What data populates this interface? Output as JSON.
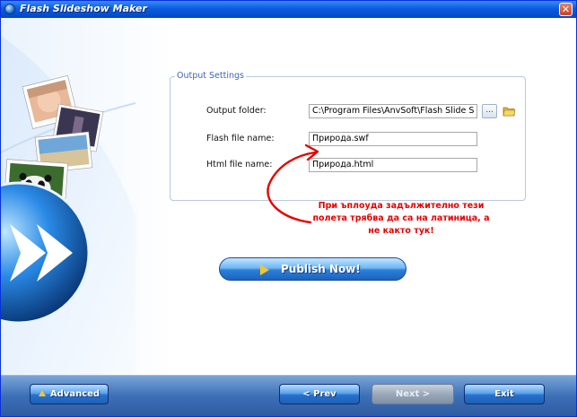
{
  "window": {
    "title": "Flash Slideshow Maker",
    "close_glyph": "✕"
  },
  "output_settings": {
    "legend": "Output Settings",
    "output_folder": {
      "label": "Output folder:",
      "value": "C:\\Program Files\\AnvSoft\\Flash Slide S",
      "browse_label": "..."
    },
    "flash_file": {
      "label": "Flash file name:",
      "value": "Природа.swf"
    },
    "html_file": {
      "label": "Html file name:",
      "value": "Природа.html"
    }
  },
  "annotation": {
    "lines": [
      "При ъплоуда задължително тези",
      "полета трябва да са на латиница, а",
      "не както тук!"
    ],
    "color": "#e60000"
  },
  "publish": {
    "label": "Publish Now!"
  },
  "footer": {
    "advanced_label": "Advanced",
    "prev_label": "< Prev",
    "next_label": "Next >",
    "exit_label": "Exit"
  },
  "icons": [
    "app-icon",
    "close-icon",
    "browse-dots-icon",
    "folder-icon",
    "publish-arrow-icon",
    "advanced-triangle-icon"
  ],
  "colors": {
    "titlebar": "#0a5ce0",
    "accent": "#2c7fd8",
    "annotation": "#e60000"
  }
}
